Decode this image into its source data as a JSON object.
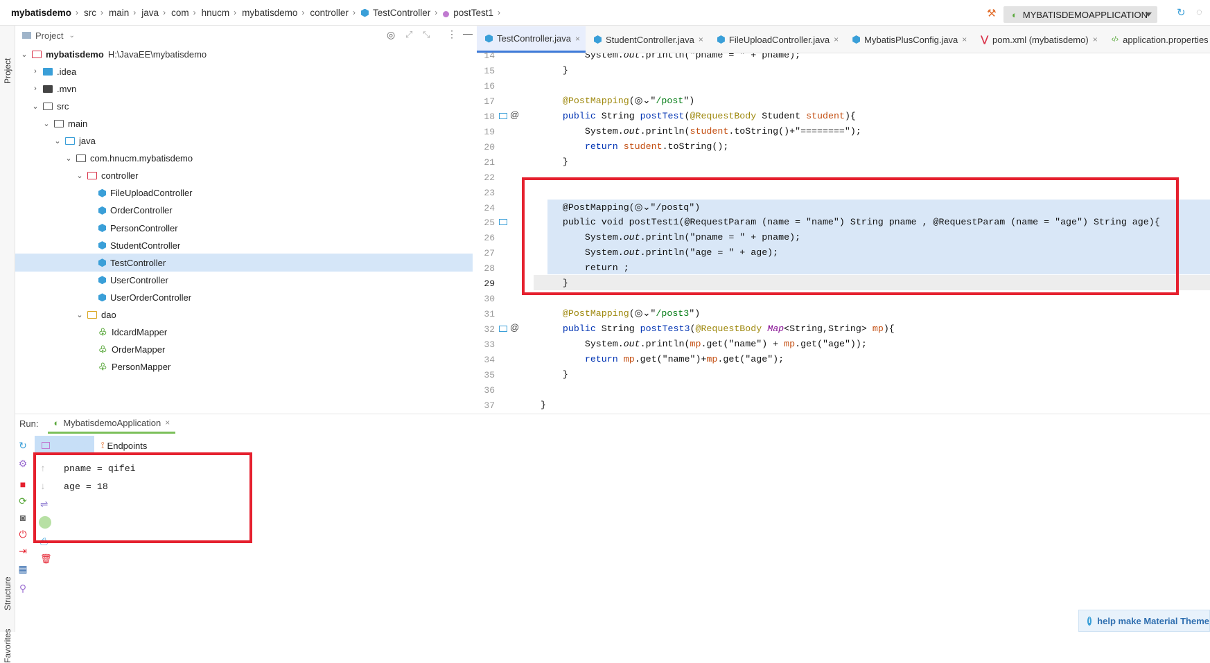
{
  "breadcrumb": [
    "mybatisdemo",
    "src",
    "main",
    "java",
    "com",
    "hnucm",
    "mybatisdemo",
    "controller",
    "TestController",
    "postTest1"
  ],
  "run_config": {
    "label": "MYBATISDEMOAPPLICATION"
  },
  "left_strip": {
    "project": "Project",
    "structure": "Structure",
    "favorites": "Favorites"
  },
  "project_panel": {
    "title": "Project"
  },
  "tree": [
    {
      "label": "mybatisdemo",
      "extra": "H:\\JavaEE\\mybatisdemo",
      "depth": 0,
      "caret": "v",
      "icon": "module",
      "selected": false
    },
    {
      "label": ".idea",
      "depth": 1,
      "caret": ">",
      "icon": "idea",
      "selected": false
    },
    {
      "label": ".mvn",
      "depth": 1,
      "caret": ">",
      "icon": "folder-dark",
      "selected": false
    },
    {
      "label": "src",
      "depth": 1,
      "caret": "v",
      "icon": "folder",
      "selected": false
    },
    {
      "label": "main",
      "depth": 2,
      "caret": "v",
      "icon": "folder",
      "selected": false
    },
    {
      "label": "java",
      "depth": 3,
      "caret": "v",
      "icon": "folder-blue",
      "selected": false
    },
    {
      "label": "com.hnucm.mybatisdemo",
      "depth": 4,
      "caret": "v",
      "icon": "folder",
      "selected": false
    },
    {
      "label": "controller",
      "depth": 5,
      "caret": "v",
      "icon": "folder-red",
      "selected": false
    },
    {
      "label": "FileUploadController",
      "depth": 6,
      "caret": "",
      "icon": "class",
      "selected": false
    },
    {
      "label": "OrderController",
      "depth": 6,
      "caret": "",
      "icon": "class",
      "selected": false
    },
    {
      "label": "PersonController",
      "depth": 6,
      "caret": "",
      "icon": "class",
      "selected": false
    },
    {
      "label": "StudentController",
      "depth": 6,
      "caret": "",
      "icon": "class",
      "selected": false
    },
    {
      "label": "TestController",
      "depth": 6,
      "caret": "",
      "icon": "class",
      "selected": true
    },
    {
      "label": "UserController",
      "depth": 6,
      "caret": "",
      "icon": "class",
      "selected": false
    },
    {
      "label": "UserOrderController",
      "depth": 6,
      "caret": "",
      "icon": "class",
      "selected": false
    },
    {
      "label": "dao",
      "depth": 5,
      "caret": "v",
      "icon": "folder-yellow",
      "selected": false
    },
    {
      "label": "IdcardMapper",
      "depth": 6,
      "caret": "",
      "icon": "mapper",
      "selected": false
    },
    {
      "label": "OrderMapper",
      "depth": 6,
      "caret": "",
      "icon": "mapper",
      "selected": false
    },
    {
      "label": "PersonMapper",
      "depth": 6,
      "caret": "",
      "icon": "mapper",
      "selected": false
    }
  ],
  "editor_tabs": [
    {
      "label": "TestController.java",
      "active": true,
      "icon": "class"
    },
    {
      "label": "StudentController.java",
      "active": false,
      "icon": "class"
    },
    {
      "label": "FileUploadController.java",
      "active": false,
      "icon": "class"
    },
    {
      "label": "MybatisPlusConfig.java",
      "active": false,
      "icon": "class"
    },
    {
      "label": "pom.xml (mybatisdemo)",
      "active": false,
      "icon": "maven"
    },
    {
      "label": "application.properties",
      "active": false,
      "icon": "props"
    }
  ],
  "code_lines": [
    {
      "n": "14",
      "html": "        System.<i>out</i>.println(\"pname = \" + pname);"
    },
    {
      "n": "15",
      "html": "    }"
    },
    {
      "n": "16",
      "html": ""
    },
    {
      "n": "17",
      "html": "    <span class='ann'>@PostMapping</span>(◎⌄\"<span class='str'>/post</span>\")"
    },
    {
      "n": "18",
      "html": "    <span class='kw'>public</span> String <span class='kw'>postTest</span>(<span class='ann'>@RequestBody</span> Student <span class='param'>student</span>){"
    },
    {
      "n": "19",
      "html": "        System.<span class='fld it'>out</span>.println(<span class='param'>student</span>.toString()+\"========\");"
    },
    {
      "n": "20",
      "html": "        <span class='kw'>return</span> <span class='param'>student</span>.toString();"
    },
    {
      "n": "21",
      "html": "    }"
    },
    {
      "n": "22",
      "html": ""
    },
    {
      "n": "23",
      "html": ""
    },
    {
      "n": "24",
      "html": "    @PostMapping(◎⌄\"/postq\")"
    },
    {
      "n": "25",
      "html": "    public void postTest1(@RequestParam (name = \"name\") String pname , @RequestParam (name = \"age\") String age){"
    },
    {
      "n": "26",
      "html": "        System.<i>out</i>.println(\"pname = \" + pname);"
    },
    {
      "n": "27",
      "html": "        System.<i>out</i>.println(\"age = \" + age);"
    },
    {
      "n": "28",
      "html": "        return ;"
    },
    {
      "n": "29",
      "html": "    }"
    },
    {
      "n": "30",
      "html": ""
    },
    {
      "n": "31",
      "html": "    <span class='ann'>@PostMapping</span>(◎⌄\"<span class='str'>/post3</span>\")"
    },
    {
      "n": "32",
      "html": "    <span class='kw'>public</span> String <span class='kw'>postTest3</span>(<span class='ann'>@RequestBody</span> <i class='fld'>Map</i>&lt;String,String&gt; <span class='param'>mp</span>){"
    },
    {
      "n": "33",
      "html": "        System.<span class='fld it'>out</span>.println(<span class='param'>mp</span>.get(\"name\") + <span class='param'>mp</span>.get(\"age\"));"
    },
    {
      "n": "34",
      "html": "        <span class='kw'>return</span> <span class='param'>mp</span>.get(\"name\")+<span class='param'>mp</span>.get(\"age\");"
    },
    {
      "n": "35",
      "html": "    }"
    },
    {
      "n": "36",
      "html": ""
    },
    {
      "n": "37",
      "html": "}"
    }
  ],
  "run_panel": {
    "label": "Run:",
    "tab": "MybatisdemoApplication",
    "console_tab": "Console",
    "endpoints_tab": "Endpoints"
  },
  "console_lines": [
    "pname = qifei",
    "age = 18"
  ],
  "notification": {
    "text": "help make Material Theme"
  }
}
